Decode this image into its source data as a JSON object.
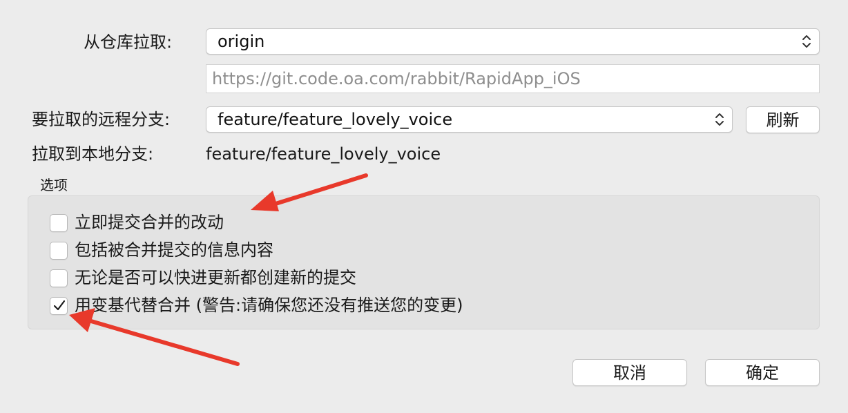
{
  "form": {
    "repo_label": "从仓库拉取:",
    "repo_value": "origin",
    "repo_url": "https://git.code.oa.com/rabbit/RapidApp_iOS",
    "remote_branch_label": "要拉取的远程分支:",
    "remote_branch_value": "feature/feature_lovely_voice",
    "refresh_label": "刷新",
    "local_branch_label": "拉取到本地分支:",
    "local_branch_value": "feature/feature_lovely_voice"
  },
  "options": {
    "title": "选项",
    "items": [
      {
        "label": "立即提交合并的改动",
        "checked": false
      },
      {
        "label": "包括被合并提交的信息内容",
        "checked": false
      },
      {
        "label": "无论是否可以快进更新都创建新的提交",
        "checked": false
      },
      {
        "label": "用变基代替合并 (警告:请确保您还没有推送您的变更)",
        "checked": true
      }
    ]
  },
  "footer": {
    "cancel_label": "取消",
    "ok_label": "确定"
  },
  "colors": {
    "annotation_arrow": "#e8392b",
    "background": "#ececec"
  },
  "icons": {
    "popup_indicator": "chevron-up-down-icon",
    "checkbox_check": "checkmark-icon",
    "annotation": "arrow-icon"
  }
}
